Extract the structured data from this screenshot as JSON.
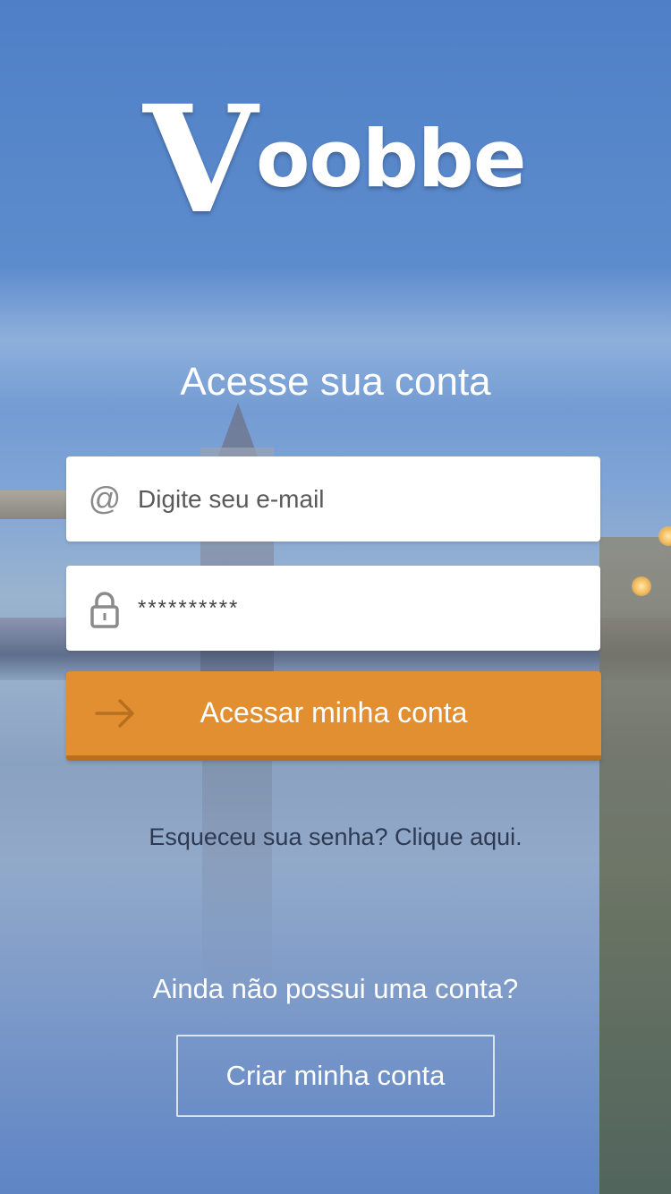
{
  "brand": {
    "logo_v": "V",
    "logo_rest": "oobbe"
  },
  "login": {
    "title": "Acesse sua conta",
    "email": {
      "icon": "at-icon",
      "icon_glyph": "@",
      "placeholder": "Digite seu e-mail",
      "value": ""
    },
    "password": {
      "icon": "lock-icon",
      "value": "**********"
    },
    "submit": {
      "icon": "arrow-right-icon",
      "label": "Acessar minha conta"
    },
    "forgot_link": "Esqueceu sua senha? Clique aqui."
  },
  "signup": {
    "prompt": "Ainda não possui uma conta?",
    "button_label": "Criar minha conta"
  },
  "colors": {
    "accent": "#e18f31",
    "accent_dark": "#b96f1e",
    "field_bg": "#ffffff",
    "text_light": "#ffffff",
    "link_text": "#2e3a52"
  }
}
